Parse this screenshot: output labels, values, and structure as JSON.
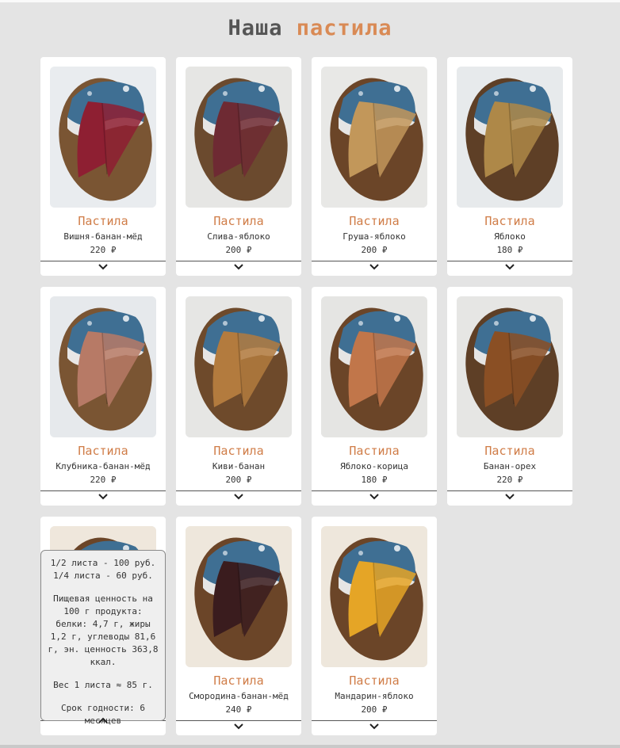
{
  "page": {
    "title_part1": "Наша",
    "title_part2": "пастила"
  },
  "colors": {
    "accent": "#d07d48",
    "background": "#e4e4e4",
    "card": "#ffffff"
  },
  "products": [
    {
      "category": "Пастила",
      "flavor": "Вишня-банан-мёд",
      "price": "220 ₽",
      "fruit_color": "#8e1f32",
      "board": "#7a5533",
      "bg": "#e9ecef"
    },
    {
      "category": "Пастила",
      "flavor": "Слива-яблоко",
      "price": "200 ₽",
      "fruit_color": "#6e2a33",
      "board": "#6b4a2e",
      "bg": "#e6e6e4"
    },
    {
      "category": "Пастила",
      "flavor": "Груша-яблоко",
      "price": "200 ₽",
      "fruit_color": "#c2975a",
      "board": "#6b4528",
      "bg": "#e8e8e6"
    },
    {
      "category": "Пастила",
      "flavor": "Яблоко",
      "price": "180 ₽",
      "fruit_color": "#ae8848",
      "board": "#5e3f26",
      "bg": "#e7eaec"
    },
    {
      "category": "Пастила",
      "flavor": "Клубника-банан-мёд",
      "price": "220 ₽",
      "fruit_color": "#b77a66",
      "board": "#7a5533",
      "bg": "#e6e9ec"
    },
    {
      "category": "Пастила",
      "flavor": "Киви-банан",
      "price": "200 ₽",
      "fruit_color": "#b37b3e",
      "board": "#6e4a2b",
      "bg": "#e6e6e4"
    },
    {
      "category": "Пастила",
      "flavor": "Яблоко-корица",
      "price": "180 ₽",
      "fruit_color": "#c1764a",
      "board": "#6b4528",
      "bg": "#e5e5e3"
    },
    {
      "category": "Пастила",
      "flavor": "Банан-орех",
      "price": "220 ₽",
      "fruit_color": "#8a4f24",
      "board": "#5e3f26",
      "bg": "#e6e6e4"
    },
    {
      "category": "Пастила",
      "flavor": "",
      "price": "",
      "fruit_color": "#9a6a48",
      "board": "#6b4528",
      "bg": "#efe7dc"
    },
    {
      "category": "Пастила",
      "flavor": "Смородина-банан-мёд",
      "price": "240 ₽",
      "fruit_color": "#3a1c1e",
      "board": "#6b4528",
      "bg": "#eee7dc"
    },
    {
      "category": "Пастила",
      "flavor": "Мандарин-яблоко",
      "price": "200 ₽",
      "fruit_color": "#e5a526",
      "board": "#6b4528",
      "bg": "#eee7dc"
    }
  ],
  "popup": {
    "line1": "1/2 листа - 100 руб.",
    "line2": "1/4 листа - 60 руб.",
    "nutrition": "Пищевая ценность на 100 г продукта: белки: 4,7 г, жиры 1,2 г, углеводы 81,6 г, эн. ценность 363,8 ккал.",
    "weight": "Вес 1 листа ≈ 85 г.",
    "shelf": "Срок годности: 6 месяцев"
  },
  "icons": {
    "expand": "chevron-down-icon",
    "collapse": "chevron-up-icon"
  }
}
